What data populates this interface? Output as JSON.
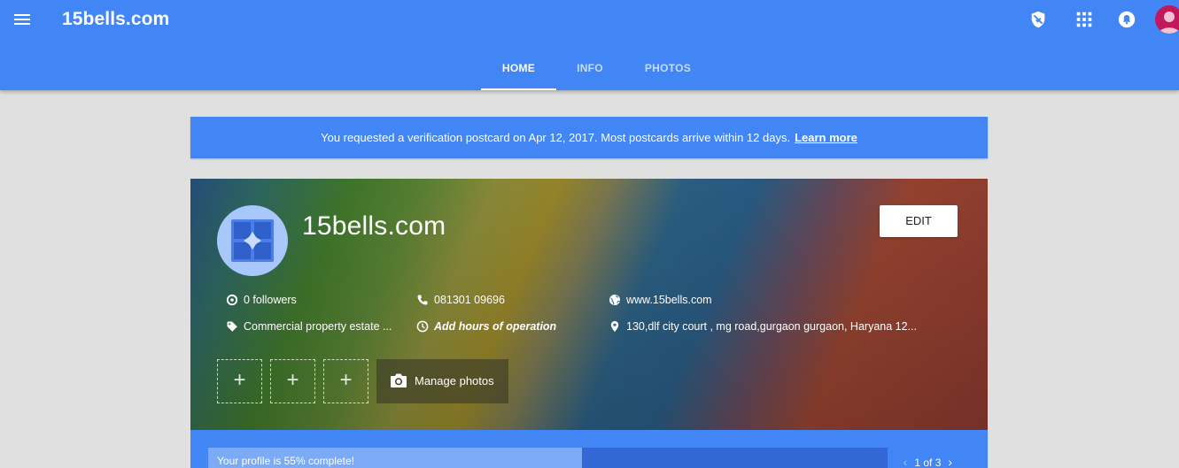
{
  "header": {
    "brand": "15bells.com",
    "icons": [
      "menu-icon",
      "shield-icon",
      "apps-grid-icon",
      "notifications-icon",
      "account-avatar"
    ]
  },
  "tabs": [
    {
      "label": "HOME",
      "active": true
    },
    {
      "label": "INFO",
      "active": false
    },
    {
      "label": "PHOTOS",
      "active": false
    }
  ],
  "notice": {
    "text": "You requested a verification postcard on Apr 12, 2017. Most postcards arrive within 12 days.",
    "link": "Learn more"
  },
  "business": {
    "name": "15bells.com",
    "edit_label": "EDIT",
    "followers": "0 followers",
    "phone": "081301 09696",
    "website": "www.15bells.com",
    "category": "Commercial property estate ...",
    "hours": "Add hours of operation",
    "address": "130,dlf city court , mg road,gurgaon gurgaon, Haryana 12...",
    "photo_slot_symbol": "+",
    "manage_photos_label": "Manage photos"
  },
  "progress": {
    "text": "Your profile is 55% complete!",
    "percent": 55,
    "pager": "1 of 3"
  },
  "colors": {
    "primary": "#4285f4",
    "page_background": "#e0e0e0",
    "progress_fill": "#7baaf7",
    "progress_track": "#3367d6",
    "avatar": "#c2185b"
  }
}
